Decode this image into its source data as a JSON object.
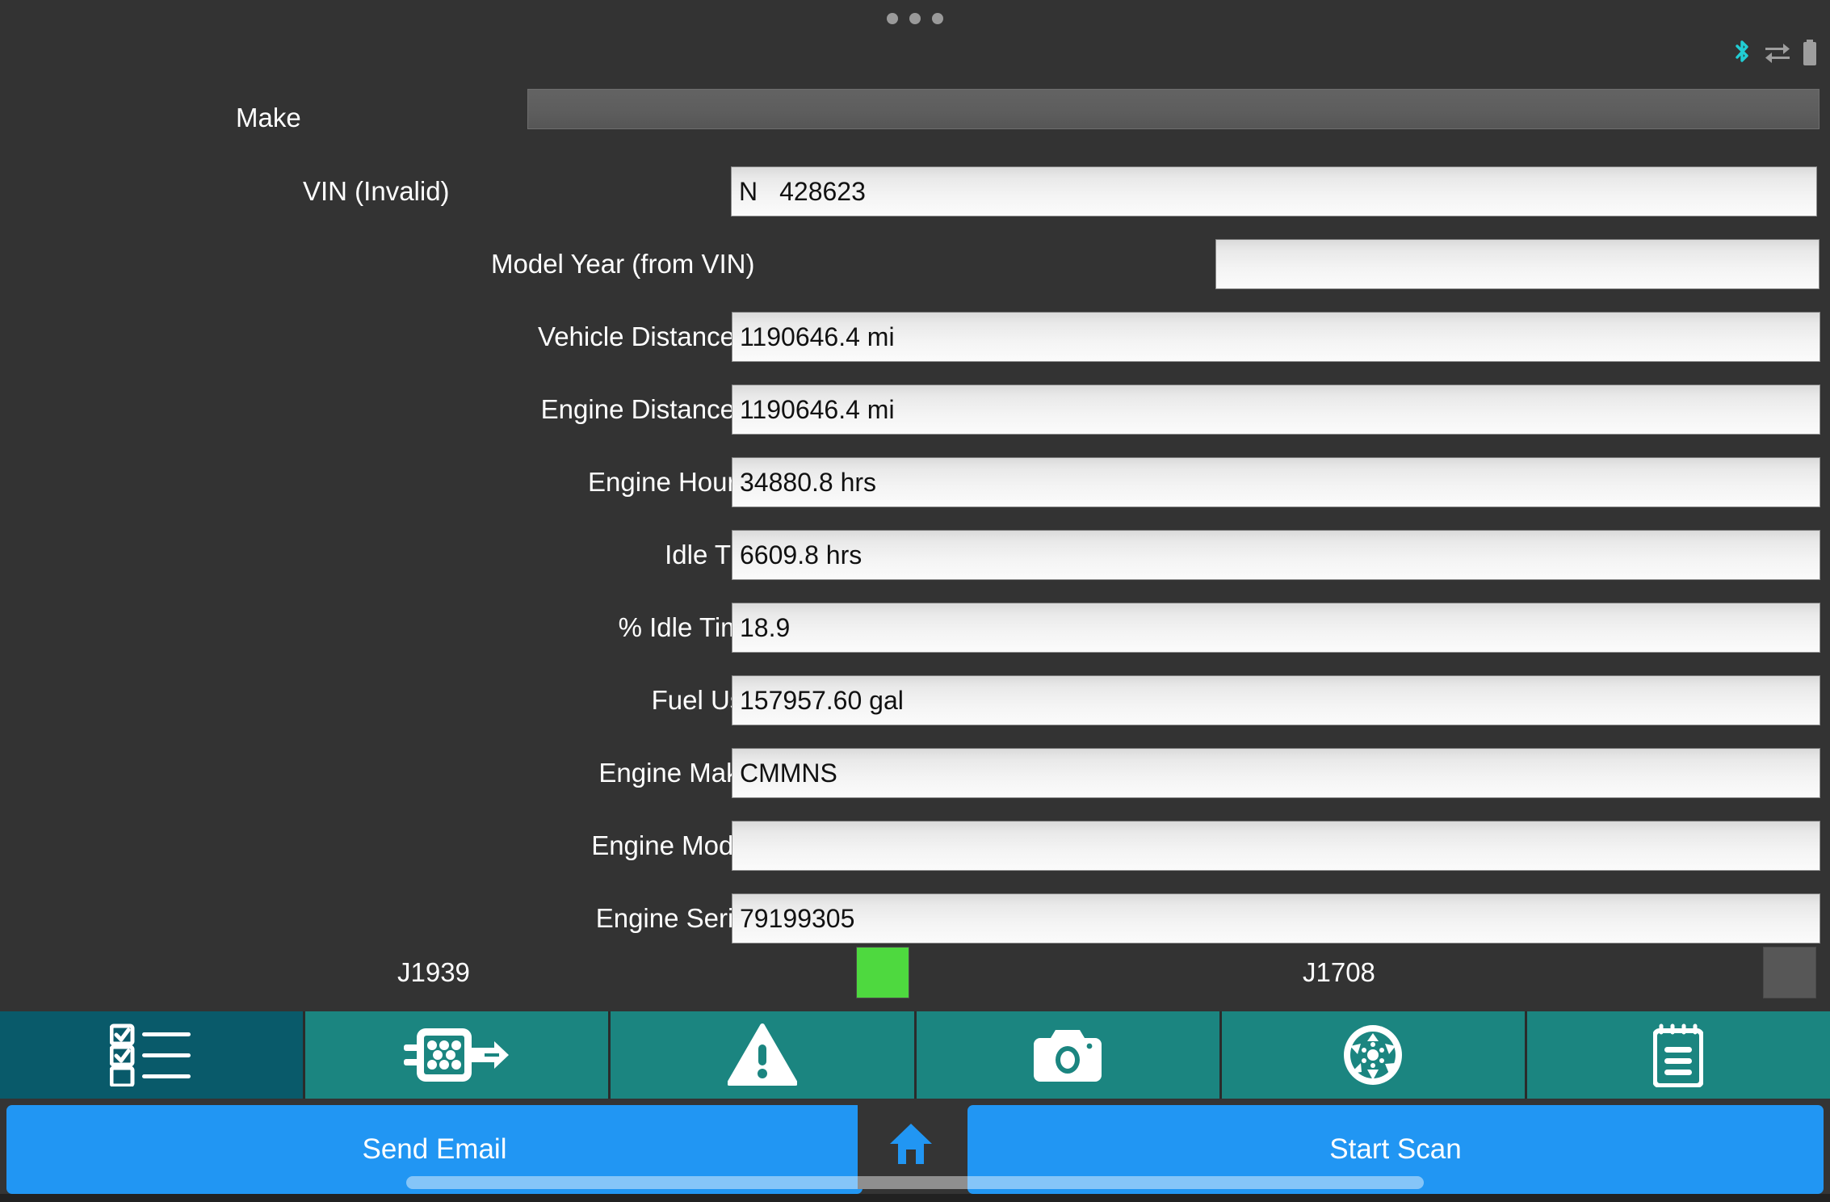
{
  "statusbar": {
    "overflow_dots": "overflow-dots",
    "icons": [
      {
        "name": "bluetooth-icon",
        "color": "#21CDD4"
      },
      {
        "name": "data-transfer-icon",
        "color": "#9e9e9e"
      },
      {
        "name": "battery-icon",
        "color": "#9e9e9e"
      }
    ]
  },
  "form": {
    "make": {
      "label": "Make",
      "value": ""
    },
    "vin": {
      "label": "VIN (Invalid)",
      "prefix": "N",
      "number": "428623"
    },
    "model_year": {
      "label": "Model Year (from VIN)",
      "value": ""
    },
    "rows": [
      {
        "label": "Vehicle Distance",
        "value": "1190646.4 mi",
        "cls": "lbl-vehdist"
      },
      {
        "label": "Engine Distance",
        "value": "1190646.4 mi",
        "cls": "lbl-engdist"
      },
      {
        "label": "Engine Hours",
        "value": "34880.8 hrs",
        "cls": "lbl-enghours"
      },
      {
        "label": "Idle Time",
        "value": "6609.8 hrs",
        "cls": "lbl-idletime"
      },
      {
        "label": "% Idle Time",
        "value": "18.9",
        "cls": "lbl-pctidle"
      },
      {
        "label": "Fuel Used",
        "value": "157957.60 gal",
        "cls": "lbl-fuelused"
      },
      {
        "label": "Engine Make",
        "value": "CMMNS",
        "cls": "lbl-engmake"
      },
      {
        "label": "Engine Model",
        "value": "",
        "cls": "lbl-engmodel"
      },
      {
        "label": "Engine Serial",
        "value": "79199305",
        "cls": "lbl-engserial"
      }
    ]
  },
  "protocols": {
    "j1939": {
      "label": "J1939",
      "status": "active",
      "color": "#4ED93F"
    },
    "j1708": {
      "label": "J1708",
      "status": "inactive",
      "color": "#575757"
    }
  },
  "tabbar": {
    "selected_index": 0,
    "selected_color": "#095A6A",
    "unselected_color": "#1B8580",
    "tabs": [
      {
        "icon": "checklist-icon",
        "name": "tab-checklist"
      },
      {
        "icon": "connector-plug-icon",
        "name": "tab-connector"
      },
      {
        "icon": "warning-triangle-icon",
        "name": "tab-faults"
      },
      {
        "icon": "camera-icon",
        "name": "tab-camera"
      },
      {
        "icon": "wheel-icon",
        "name": "tab-wheel"
      },
      {
        "icon": "notepad-icon",
        "name": "tab-notes"
      }
    ]
  },
  "actionbar": {
    "send_email_label": "Send Email",
    "start_scan_label": "Start Scan",
    "home_icon": "home-icon",
    "button_color": "#2196F3"
  }
}
